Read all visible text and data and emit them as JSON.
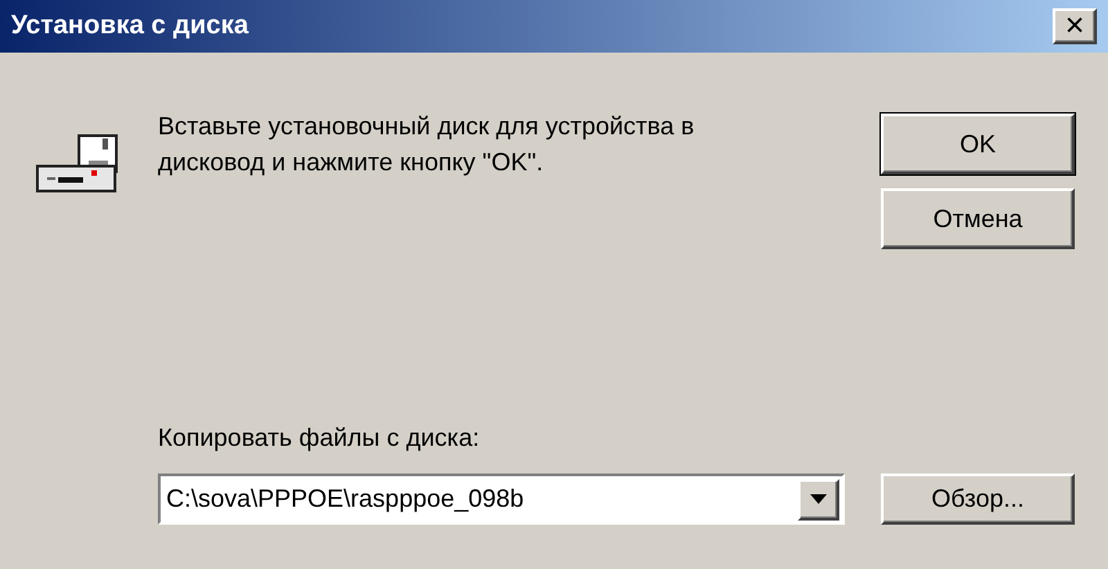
{
  "window": {
    "title": "Установка с диска",
    "close": "×"
  },
  "message": "Вставьте установочный диск для устройства в дисковод и нажмите кнопку \"OK\".",
  "buttons": [
    {
      "label": "OK",
      "default": true
    },
    {
      "label": "Отмена",
      "default": false
    }
  ],
  "copy_from": {
    "label": "Копировать файлы с диска:",
    "value": "C:\\sova\\PPPOE\\raspppoe_098b",
    "browse": "Обзор..."
  }
}
